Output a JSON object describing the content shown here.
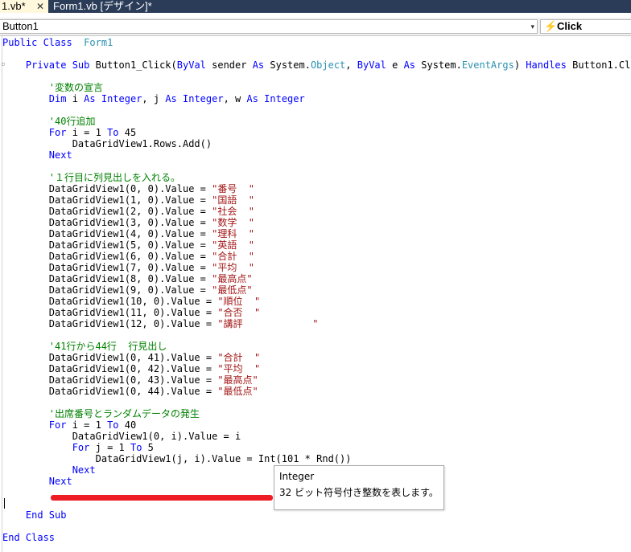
{
  "tabs": [
    {
      "label": "1.vb*",
      "close": "✕"
    },
    {
      "label": "Form1.vb [デザイン]*"
    }
  ],
  "nav": {
    "object_combo": "Button1",
    "event_combo": "Click",
    "dropdown_glyph": "▾"
  },
  "code_lines": [
    {
      "indent": "",
      "parts": [
        [
          "kw",
          "Public"
        ],
        [
          "",
          ""
        ],
        [
          "kw",
          " Class"
        ],
        [
          "",
          "  "
        ],
        [
          "ty",
          "Form1"
        ]
      ]
    },
    {
      "indent": "",
      "parts": []
    },
    {
      "indent": "    ",
      "parts": [
        [
          "kw",
          "Private Sub"
        ],
        [
          "",
          " Button1_Click("
        ],
        [
          "kw",
          "ByVal"
        ],
        [
          "",
          " sender "
        ],
        [
          "kw",
          "As"
        ],
        [
          "",
          " System."
        ],
        [
          "ty",
          "Object"
        ],
        [
          "",
          ", "
        ],
        [
          "kw",
          "ByVal"
        ],
        [
          "",
          " e "
        ],
        [
          "kw",
          "As"
        ],
        [
          "",
          " System."
        ],
        [
          "ty",
          "EventArgs"
        ],
        [
          "",
          ") "
        ],
        [
          "kw",
          "Handles"
        ],
        [
          "",
          " Button1.Click"
        ]
      ]
    },
    {
      "indent": "",
      "parts": []
    },
    {
      "indent": "        ",
      "parts": [
        [
          "cm",
          "'変数の宣言"
        ]
      ]
    },
    {
      "indent": "        ",
      "parts": [
        [
          "kw",
          "Dim"
        ],
        [
          "",
          " i "
        ],
        [
          "kw",
          "As Integer"
        ],
        [
          "",
          ", j "
        ],
        [
          "kw",
          "As Integer"
        ],
        [
          "",
          ", w "
        ],
        [
          "kw",
          "As Integer"
        ]
      ]
    },
    {
      "indent": "",
      "parts": []
    },
    {
      "indent": "        ",
      "parts": [
        [
          "cm",
          "'40行追加"
        ]
      ]
    },
    {
      "indent": "        ",
      "parts": [
        [
          "kw",
          "For"
        ],
        [
          "",
          " i = 1 "
        ],
        [
          "kw",
          "To"
        ],
        [
          "",
          " 45"
        ]
      ]
    },
    {
      "indent": "            ",
      "parts": [
        [
          "",
          "DataGridView1.Rows.Add()"
        ]
      ]
    },
    {
      "indent": "        ",
      "parts": [
        [
          "kw",
          "Next"
        ]
      ]
    },
    {
      "indent": "",
      "parts": []
    },
    {
      "indent": "        ",
      "parts": [
        [
          "cm",
          "'１行目に列見出しを入れる。"
        ]
      ]
    },
    {
      "indent": "        ",
      "parts": [
        [
          "",
          "DataGridView1(0, 0).Value = "
        ],
        [
          "str",
          "\"番号  \""
        ]
      ]
    },
    {
      "indent": "        ",
      "parts": [
        [
          "",
          "DataGridView1(1, 0).Value = "
        ],
        [
          "str",
          "\"国語  \""
        ]
      ]
    },
    {
      "indent": "        ",
      "parts": [
        [
          "",
          "DataGridView1(2, 0).Value = "
        ],
        [
          "str",
          "\"社会  \""
        ]
      ]
    },
    {
      "indent": "        ",
      "parts": [
        [
          "",
          "DataGridView1(3, 0).Value = "
        ],
        [
          "str",
          "\"数学  \""
        ]
      ]
    },
    {
      "indent": "        ",
      "parts": [
        [
          "",
          "DataGridView1(4, 0).Value = "
        ],
        [
          "str",
          "\"理科  \""
        ]
      ]
    },
    {
      "indent": "        ",
      "parts": [
        [
          "",
          "DataGridView1(5, 0).Value = "
        ],
        [
          "str",
          "\"英語  \""
        ]
      ]
    },
    {
      "indent": "        ",
      "parts": [
        [
          "",
          "DataGridView1(6, 0).Value = "
        ],
        [
          "str",
          "\"合計  \""
        ]
      ]
    },
    {
      "indent": "        ",
      "parts": [
        [
          "",
          "DataGridView1(7, 0).Value = "
        ],
        [
          "str",
          "\"平均  \""
        ]
      ]
    },
    {
      "indent": "        ",
      "parts": [
        [
          "",
          "DataGridView1(8, 0).Value = "
        ],
        [
          "str",
          "\"最高点\""
        ]
      ]
    },
    {
      "indent": "        ",
      "parts": [
        [
          "",
          "DataGridView1(9, 0).Value = "
        ],
        [
          "str",
          "\"最低点\""
        ]
      ]
    },
    {
      "indent": "        ",
      "parts": [
        [
          "",
          "DataGridView1(10, 0).Value = "
        ],
        [
          "str",
          "\"順位  \""
        ]
      ]
    },
    {
      "indent": "        ",
      "parts": [
        [
          "",
          "DataGridView1(11, 0).Value = "
        ],
        [
          "str",
          "\"合否  \""
        ]
      ]
    },
    {
      "indent": "        ",
      "parts": [
        [
          "",
          "DataGridView1(12, 0).Value = "
        ],
        [
          "str",
          "\"講評            \""
        ]
      ]
    },
    {
      "indent": "",
      "parts": []
    },
    {
      "indent": "        ",
      "parts": [
        [
          "cm",
          "'41行から44行  行見出し"
        ]
      ]
    },
    {
      "indent": "        ",
      "parts": [
        [
          "",
          "DataGridView1(0, 41).Value = "
        ],
        [
          "str",
          "\"合計  \""
        ]
      ]
    },
    {
      "indent": "        ",
      "parts": [
        [
          "",
          "DataGridView1(0, 42).Value = "
        ],
        [
          "str",
          "\"平均  \""
        ]
      ]
    },
    {
      "indent": "        ",
      "parts": [
        [
          "",
          "DataGridView1(0, 43).Value = "
        ],
        [
          "str",
          "\"最高点\""
        ]
      ]
    },
    {
      "indent": "        ",
      "parts": [
        [
          "",
          "DataGridView1(0, 44).Value = "
        ],
        [
          "str",
          "\"最低点\""
        ]
      ]
    },
    {
      "indent": "",
      "parts": []
    },
    {
      "indent": "        ",
      "parts": [
        [
          "cm",
          "'出席番号とランダムデータの発生"
        ]
      ]
    },
    {
      "indent": "        ",
      "parts": [
        [
          "kw",
          "For"
        ],
        [
          "",
          " i = 1 "
        ],
        [
          "kw",
          "To"
        ],
        [
          "",
          " 40"
        ]
      ]
    },
    {
      "indent": "            ",
      "parts": [
        [
          "",
          "DataGridView1(0, i).Value = i"
        ]
      ]
    },
    {
      "indent": "            ",
      "parts": [
        [
          "kw",
          "For"
        ],
        [
          "",
          " j = 1 "
        ],
        [
          "kw",
          "To"
        ],
        [
          "",
          " 5"
        ]
      ]
    },
    {
      "indent": "                ",
      "parts": [
        [
          "",
          "DataGridView1(j, i).Value = Int(101 * Rnd())"
        ]
      ]
    },
    {
      "indent": "            ",
      "parts": [
        [
          "kw",
          "Next"
        ]
      ]
    },
    {
      "indent": "        ",
      "parts": [
        [
          "kw",
          "Next"
        ]
      ]
    },
    {
      "indent": "",
      "parts": []
    },
    {
      "indent": "",
      "parts": []
    },
    {
      "indent": "    ",
      "parts": [
        [
          "kw",
          "End Sub"
        ]
      ]
    },
    {
      "indent": "",
      "parts": []
    },
    {
      "indent": "",
      "parts": [
        [
          "kw",
          "End Class"
        ]
      ]
    }
  ],
  "tooltip": {
    "title": "Integer",
    "description": "32 ビット符号付き整数を表します。"
  },
  "colors": {
    "keyword": "#0000ff",
    "string": "#a31515",
    "comment": "#008000",
    "type": "#2b91af",
    "annotation_line": "#ee1c24"
  }
}
